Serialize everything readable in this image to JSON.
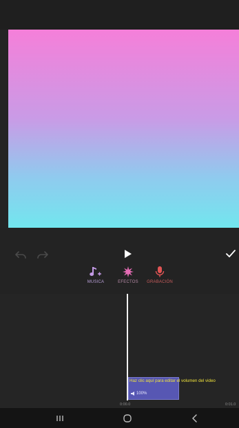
{
  "editor": {
    "tools": [
      {
        "label": "MUSICA",
        "icon": "music-note-add-icon",
        "color": "#c49be6"
      },
      {
        "label": "EFECTOS",
        "icon": "effects-burst-icon",
        "color": "#e46cb4"
      },
      {
        "label": "GRABACIÓN",
        "icon": "microphone-icon",
        "color": "#e05454"
      }
    ],
    "timeline": {
      "hint": "Haz clic aquí para editar el volumen del video",
      "clip_volume": "100%",
      "time_start": "0:00.0",
      "time_end": "0:01.0"
    }
  },
  "colors": {
    "gradient_top": "#f57fd9",
    "gradient_bottom": "#72e6ee",
    "hint_text": "#f0e33b",
    "clip_fill": "#6060cd"
  }
}
